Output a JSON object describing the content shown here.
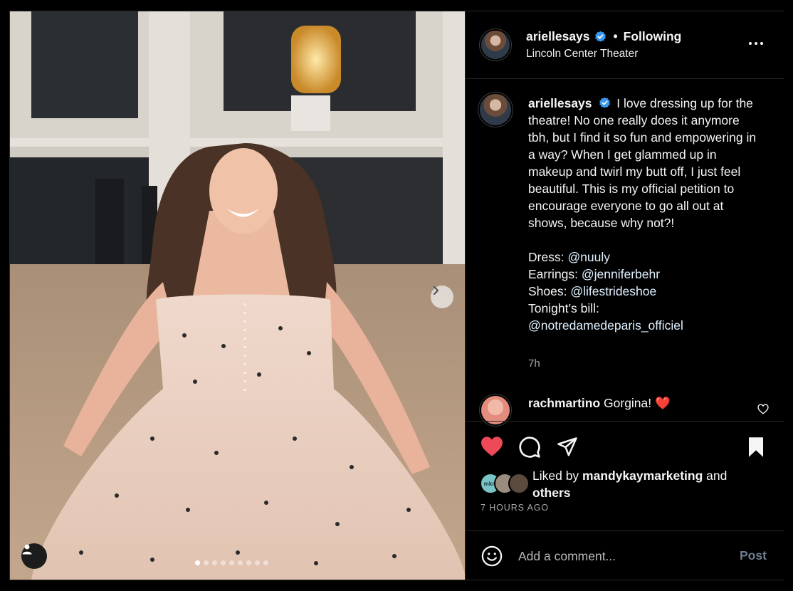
{
  "post": {
    "username": "ariellesays",
    "follow_status": "Following",
    "separator": "•",
    "location": "Lincoln Center Theater"
  },
  "caption": {
    "username": "ariellesays",
    "text": "I love dressing up for the theatre! No one really does it anymore tbh, but I find it so fun and empowering in a way? When I get glammed up in makeup and twirl my butt off, I just feel beautiful. This is my official petition to encourage everyone to go all out at shows, because why not?!",
    "credits": [
      {
        "label": "Dress: ",
        "handle": "@nuuly"
      },
      {
        "label": "Earrings: ",
        "handle": "@jenniferbehr"
      },
      {
        "label": "Shoes: ",
        "handle": "@lifestrideshoe"
      }
    ],
    "bill_label": "Tonight’s bill:",
    "bill_handle": "@notredamedeparis_officiel",
    "time": "7h"
  },
  "comment": {
    "username": "rachmartino",
    "text": "Gorgina! ❤️"
  },
  "likes": {
    "prefix": "Liked by ",
    "top_liker": "mandykaymarketing",
    "middle": " and",
    "others": "others",
    "liker_badge": "mkm"
  },
  "timestamp": "7 HOURS AGO",
  "composer": {
    "placeholder": "Add a comment...",
    "post_label": "Post"
  },
  "carousel": {
    "count": 9,
    "active_index": 0
  },
  "colors": {
    "like_red": "#ed4956",
    "verified_blue": "#3897f0",
    "mention": "#e0f1ff",
    "post_disabled": "#6e7c91"
  }
}
